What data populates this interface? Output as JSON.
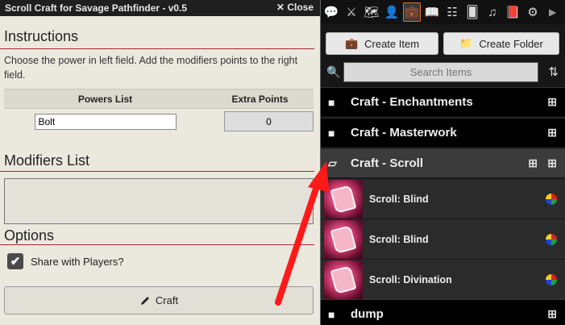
{
  "dialog": {
    "title": "Scroll Craft for Savage Pathfinder - v0.5",
    "close_label": "Close",
    "close_glyph": "✕",
    "instructions_heading": "Instructions",
    "instructions_text": "Choose the power in left field. Add the modifiers points to the right field.",
    "table": {
      "col_powers": "Powers List",
      "col_extra": "Extra Points",
      "power_value": "Bolt",
      "extra_value": "0"
    },
    "modifiers_heading": "Modifiers List",
    "options_heading": "Options",
    "share_label": "Share with Players?",
    "share_checked": "✔",
    "craft_label": "Craft",
    "craft_icon": "pencil-icon"
  },
  "sidebar": {
    "tabs": [
      {
        "icon": "chat-icon",
        "glyph": "💬"
      },
      {
        "icon": "combat-icon",
        "glyph": "⚔"
      },
      {
        "icon": "scenes-icon",
        "glyph": "🗺"
      },
      {
        "icon": "actors-icon",
        "glyph": "👤"
      },
      {
        "icon": "items-icon",
        "glyph": "💼"
      },
      {
        "icon": "journal-icon",
        "glyph": "📖"
      },
      {
        "icon": "tables-icon",
        "glyph": "☷"
      },
      {
        "icon": "cards-icon",
        "glyph": "🂠"
      },
      {
        "icon": "playlists-icon",
        "glyph": "♫"
      },
      {
        "icon": "compendium-icon",
        "glyph": "📕"
      },
      {
        "icon": "settings-icon",
        "glyph": "⚙"
      }
    ],
    "more_glyph": "▶",
    "create_item": "Create Item",
    "create_folder": "Create Folder",
    "search_placeholder": "Search Items",
    "folders": [
      {
        "name": "Craft - Enchantments"
      },
      {
        "name": "Craft - Masterwork"
      },
      {
        "name": "Craft - Scroll"
      },
      {
        "name": "dump"
      }
    ],
    "items": [
      {
        "name": "Scroll: Blind"
      },
      {
        "name": "Scroll: Blind"
      },
      {
        "name": "Scroll: Divination"
      }
    ]
  },
  "colors": {
    "accent_red": "#a4262c",
    "arrow_red": "#ff1a1a",
    "active_tab_border": "#e07020"
  }
}
